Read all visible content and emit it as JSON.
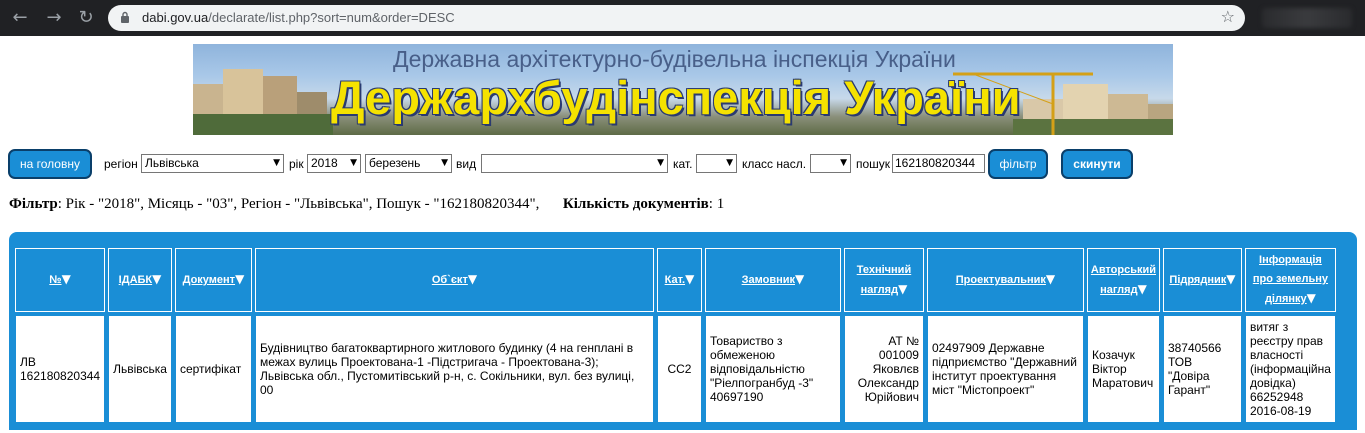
{
  "browser": {
    "url_host": "dabi.gov.ua",
    "url_path": "/declarate/list.php?sort=num&order=DESC"
  },
  "banner": {
    "subtitle": "Державна архітектурно-будівельна інспекція України",
    "title": "Держархбудінспекція України"
  },
  "filter_bar": {
    "home_button": "на головну",
    "region_label": "регіон",
    "region_value": "Львівська",
    "year_label": "рік",
    "year_value": "2018",
    "month_value": "березень",
    "type_label": "вид",
    "type_value": "",
    "category_label": "кат.",
    "category_value": "",
    "class_label": "класс насл.",
    "class_value": "",
    "search_label": "пошук",
    "search_value": "162180820344",
    "filter_button": "фільтр",
    "reset_button": "скинути"
  },
  "summary": {
    "filter_label": "Фільтр",
    "filter_text": ": Рік - \"2018\", Місяць - \"03\", Регіон - \"Львівська\", Пошук - \"162180820344\",",
    "count_label": "Кількість документів",
    "count_value": ": 1"
  },
  "table": {
    "headers": [
      {
        "l1": "№",
        "l2": ""
      },
      {
        "l1": "ІДАБК",
        "l2": ""
      },
      {
        "l1": "Документ",
        "l2": ""
      },
      {
        "l1": "Об`єкт",
        "l2": ""
      },
      {
        "l1": "Кат.",
        "l2": ""
      },
      {
        "l1": "Замовник",
        "l2": ""
      },
      {
        "l1": "Технічний",
        "l2": "нагляд"
      },
      {
        "l1": "Проектувальник",
        "l2": ""
      },
      {
        "l1": "Авторський",
        "l2": "нагляд"
      },
      {
        "l1": "Підрядник",
        "l2": ""
      },
      {
        "l1": "Інформація",
        "l2": "про земельну",
        "l3": "ділянку"
      }
    ],
    "rows": [
      {
        "num": "ЛВ 162180820344",
        "idabk": "Львівська",
        "document": "сертифікат",
        "object": "Будівництво багатоквартирного житлового будинку (4 на генплані в межах вулиць Проектована-1 -Підстригача - Проектована-3); Львівська обл., Пустомитівський р-н, с. Сокільники, вул. без вулиці, 00",
        "category": "СС2",
        "customer": "Товариство з обмеженою відповідальністю \"Ріелпогранбуд -3\" 40697190",
        "tech_supervision": "АТ № 001009 Яковлєв Олександр Юрійович",
        "designer": "02497909 Державне підприємство \"Державний інститут проектування міст \"Містопроект\"",
        "author_supervision": "Козачук Віктор Маратович",
        "contractor": "38740566 ТОВ \"Довіра Гарант\"",
        "land_info": "витяг з реєстру прав власності (інформаційна довідка) 66252948 2016-08-19"
      }
    ]
  }
}
